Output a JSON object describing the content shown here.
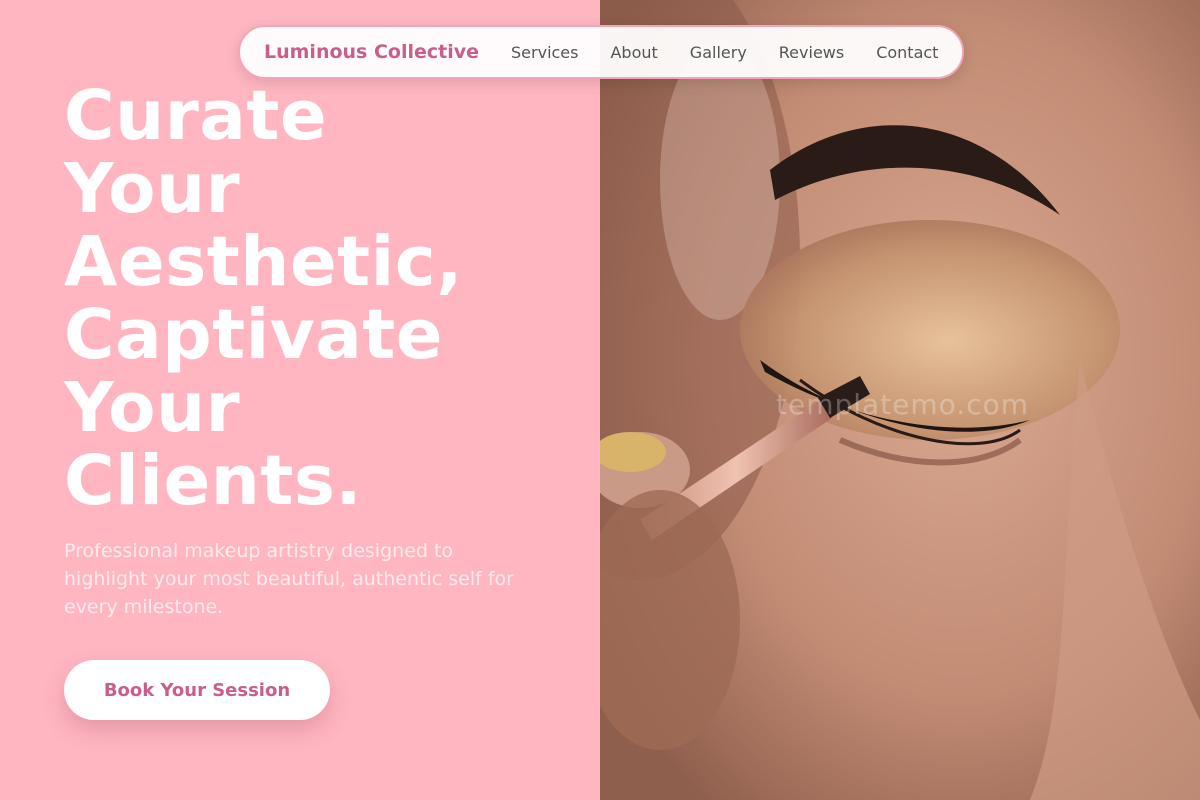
{
  "nav": {
    "brand": "Luminous Collective",
    "links": [
      "Services",
      "About",
      "Gallery",
      "Reviews",
      "Contact"
    ]
  },
  "hero": {
    "headline_lines": [
      "Curate",
      "Your",
      "Aesthetic,",
      "Captivate",
      "Your",
      "Clients."
    ],
    "subtext": "Professional makeup artistry designed to highlight your most beautiful, authentic self for every milestone.",
    "cta_label": "Book Your Session"
  },
  "image": {
    "watermark": "templatemo.com",
    "description_icon": "makeup-eye-photo"
  },
  "colors": {
    "background_pink": "#ffb6c1",
    "accent": "#c85f8a",
    "nav_border": "#f2a5b8"
  }
}
